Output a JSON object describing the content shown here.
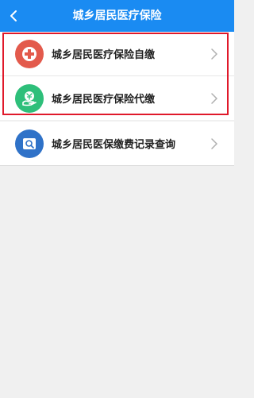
{
  "header": {
    "title": "城乡居民医疗保险",
    "back_icon": "chevron-left-icon"
  },
  "menu": {
    "items": [
      {
        "label": "城乡居民医疗保险自缴",
        "icon": "medical-cross-icon",
        "color": "#e35a4c"
      },
      {
        "label": "城乡居民医疗保险代缴",
        "icon": "yuan-hand-icon",
        "color": "#2ebf7a"
      },
      {
        "label": "城乡居民医保缴费记录查询",
        "icon": "search-record-icon",
        "color": "#2f72c8"
      }
    ]
  },
  "colors": {
    "header_bg": "#1a8bf2",
    "page_bg": "#f0f0f0",
    "highlight_border": "#e0192a"
  }
}
